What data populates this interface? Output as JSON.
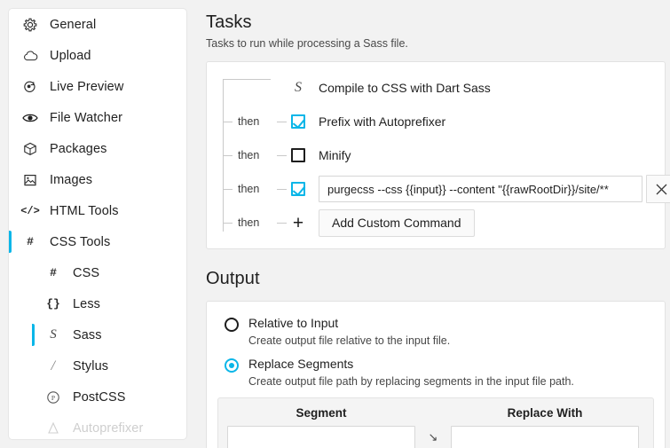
{
  "sidebar": {
    "items": [
      {
        "label": "General",
        "icon": "gear-icon",
        "glyph": "⚙",
        "level": 0,
        "active": false
      },
      {
        "label": "Upload",
        "icon": "cloud-icon",
        "glyph": "☁",
        "level": 0,
        "active": false
      },
      {
        "label": "Live Preview",
        "icon": "live-preview-icon",
        "glyph": "◎",
        "level": 0,
        "active": false
      },
      {
        "label": "File Watcher",
        "icon": "eye-icon",
        "glyph": "◉",
        "level": 0,
        "active": false
      },
      {
        "label": "Packages",
        "icon": "package-icon",
        "glyph": "⬡",
        "level": 0,
        "active": false
      },
      {
        "label": "Images",
        "icon": "image-icon",
        "glyph": "ὛB",
        "level": 0,
        "active": false
      },
      {
        "label": "HTML Tools",
        "icon": "code-icon",
        "glyph": "</>",
        "level": 0,
        "active": false
      },
      {
        "label": "CSS Tools",
        "icon": "hash-icon",
        "glyph": "#",
        "level": 0,
        "active": true
      },
      {
        "label": "CSS",
        "icon": "hash-icon",
        "glyph": "#",
        "level": 1,
        "active": false
      },
      {
        "label": "Less",
        "icon": "braces-icon",
        "glyph": "{}",
        "level": 1,
        "active": false
      },
      {
        "label": "Sass",
        "icon": "sass-icon",
        "glyph": "S",
        "level": 1,
        "active": true
      },
      {
        "label": "Stylus",
        "icon": "stylus-icon",
        "glyph": "∕",
        "level": 1,
        "active": false
      },
      {
        "label": "PostCSS",
        "icon": "postcss-icon",
        "glyph": "Ⓟ",
        "level": 1,
        "active": false
      },
      {
        "label": "Autoprefixer",
        "icon": "autoprefixer-icon",
        "glyph": "A",
        "level": 1,
        "active": false
      }
    ]
  },
  "tasks": {
    "title": "Tasks",
    "subtitle": "Tasks to run while processing a Sass file.",
    "then_label": "then",
    "rows": [
      {
        "kind": "static",
        "label": "Compile to CSS with Dart Sass",
        "icon": "sass-icon",
        "then": false
      },
      {
        "kind": "checkbox",
        "label": "Prefix with Autoprefixer",
        "icon": "checkbox-icon",
        "then": true,
        "checked": true
      },
      {
        "kind": "checkbox",
        "label": "Minify",
        "icon": "checkbox-icon",
        "then": true,
        "checked": false
      },
      {
        "kind": "command",
        "value": "purgecss --css {{input}} --content \"{{rawRootDir}}/site/**",
        "icon": "checkbox-icon",
        "then": true,
        "checked": true,
        "remove_icon": "close-icon"
      },
      {
        "kind": "add",
        "label": "Add Custom Command",
        "icon": "plus-icon",
        "then": true
      }
    ]
  },
  "output": {
    "title": "Output",
    "options": [
      {
        "label": "Relative to Input",
        "desc": "Create output file relative to the input file.",
        "selected": false
      },
      {
        "label": "Replace Segments",
        "desc": "Create output file path by replacing segments in the input file path.",
        "selected": true
      }
    ],
    "table": {
      "headers": {
        "segment": "Segment",
        "replace_with": "Replace With"
      },
      "arrow": "↘",
      "rows": [
        {
          "segment": "",
          "replace_with": ""
        }
      ]
    }
  }
}
